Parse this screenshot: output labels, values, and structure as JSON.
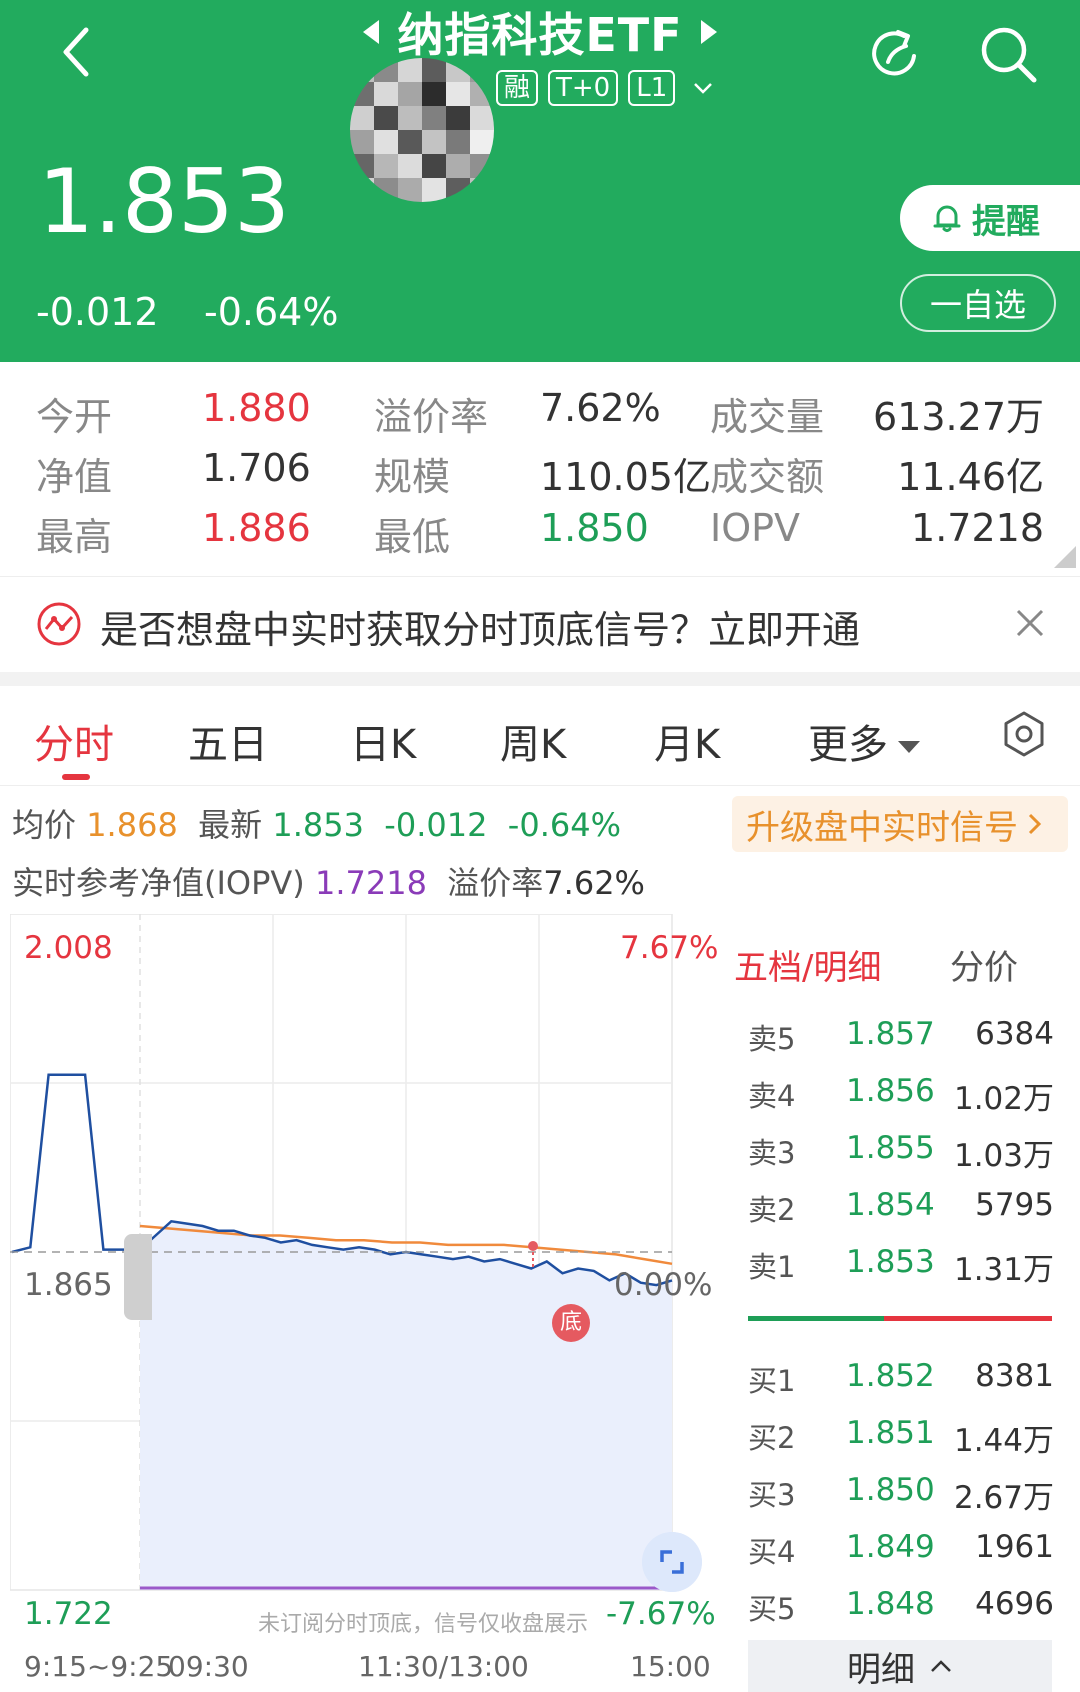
{
  "header": {
    "title": "纳指科技ETF",
    "tags": [
      "融",
      "T+0",
      "L1"
    ],
    "price": "1.853",
    "change": "-0.012",
    "change_pct": "-0.64%",
    "alert_label": "提醒",
    "watchlist_label": "一自选",
    "bg_color": "#22ab5e"
  },
  "stats": {
    "open_label": "今开",
    "open_value": "1.880",
    "premium_label": "溢价率",
    "premium_value": "7.62%",
    "volume_label": "成交量",
    "volume_value": "613.27万",
    "nav_label": "净值",
    "nav_value": "1.706",
    "scale_label": "规模",
    "scale_value": "110.05亿",
    "turnover_label": "成交额",
    "turnover_value": "11.46亿",
    "high_label": "最高",
    "high_value": "1.886",
    "low_label": "最低",
    "low_value": "1.850",
    "iopv_label": "IOPV",
    "iopv_value": "1.7218"
  },
  "banner": {
    "text": "是否想盘中实时获取分时顶底信号？立即开通"
  },
  "tabs": [
    "分时",
    "五日",
    "日K",
    "周K",
    "月K",
    "更多"
  ],
  "info": {
    "avg_label": "均价",
    "avg_value": "1.868",
    "latest_label": "最新",
    "latest_value": "1.853",
    "change": "-0.012",
    "change_pct": "-0.64%",
    "upgrade_label": "升级盘中实时信号",
    "iopv_label": "实时参考净值(IOPV)",
    "iopv_value": "1.7218",
    "premium_label": "溢价率",
    "premium_value": "7.62%"
  },
  "chart_data": {
    "type": "line",
    "y_top": "2.008",
    "y_mid": "1.865",
    "y_bottom": "1.722",
    "pct_top": "7.67%",
    "pct_mid": "0.00%",
    "pct_bottom": "-7.67%",
    "ylim": [
      1.722,
      2.008
    ],
    "x_ticks": [
      "9:15~9:25",
      "09:30",
      "11:30/13:00",
      "15:00"
    ],
    "bottom_marker": "底",
    "note": "未订阅分时顶底，信号仅收盘展示",
    "series": [
      {
        "values": [
          1.865,
          1.867,
          1.94,
          1.94,
          1.94,
          1.866,
          1.866,
          1.866,
          1.872,
          1.878,
          1.877,
          1.876,
          1.874,
          1.874,
          1.872,
          1.871,
          1.869,
          1.87,
          1.868,
          1.867,
          1.866,
          1.867,
          1.866,
          1.864,
          1.865,
          1.864,
          1.863,
          1.862,
          1.863,
          1.861,
          1.862,
          1.86,
          1.858,
          1.861,
          1.856,
          1.858,
          1.857,
          1.853,
          1.856,
          1.852,
          1.851,
          1.853
        ],
        "color": "#1f4fa0"
      },
      {
        "values": [
          1.876,
          1.875,
          1.874,
          1.873,
          1.872,
          1.872,
          1.871,
          1.87,
          1.87,
          1.869,
          1.869,
          1.868,
          1.868,
          1.868,
          1.867,
          1.866,
          1.865,
          1.864,
          1.862,
          1.86
        ],
        "color": "#f08a3c"
      }
    ]
  },
  "order_book": {
    "header": "五档/明细",
    "header2": "分价",
    "asks": [
      {
        "level": "卖5",
        "price": "1.857",
        "volume": "6384"
      },
      {
        "level": "卖4",
        "price": "1.856",
        "volume": "1.02万"
      },
      {
        "level": "卖3",
        "price": "1.855",
        "volume": "1.03万"
      },
      {
        "level": "卖2",
        "price": "1.854",
        "volume": "5795"
      },
      {
        "level": "卖1",
        "price": "1.853",
        "volume": "1.31万"
      }
    ],
    "bids": [
      {
        "level": "买1",
        "price": "1.852",
        "volume": "8381"
      },
      {
        "level": "买2",
        "price": "1.851",
        "volume": "1.44万"
      },
      {
        "level": "买3",
        "price": "1.850",
        "volume": "2.67万"
      },
      {
        "level": "买4",
        "price": "1.849",
        "volume": "1961"
      },
      {
        "level": "买5",
        "price": "1.848",
        "volume": "4696"
      }
    ],
    "detail_label": "明细"
  }
}
